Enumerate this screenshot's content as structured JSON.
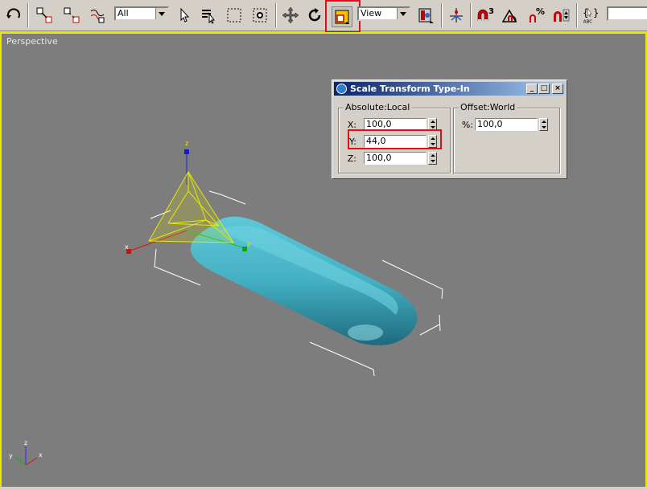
{
  "toolbar": {
    "selection_filter": "All",
    "reference_coord": "View",
    "icons": [
      "undo-icon",
      "select-link-icon",
      "unlink-icon",
      "bind-space-warp-icon",
      "select-object-icon",
      "select-by-name-icon",
      "rectangular-selection-icon",
      "window-crossing-icon",
      "select-and-move-icon",
      "select-and-rotate-icon",
      "select-and-scale-icon",
      "use-pivot-center-icon",
      "select-and-manipulate-icon",
      "snaps-toggle-icon",
      "angle-snap-icon",
      "percent-snap-icon",
      "spinner-snap-icon",
      "edit-named-selections-icon"
    ],
    "snap_label": "3",
    "percent_label": "%",
    "abc_label": "ABC",
    "highlight_color": "#e0101a"
  },
  "viewport": {
    "label": "Perspective",
    "border_color": "#e8e800",
    "background": "#7d7d7d",
    "object_color": "#4ab4c8",
    "gizmo_labels": {
      "x": "x",
      "y": "y",
      "z": "z"
    },
    "axis_tripod": {
      "x": "x",
      "y": "y",
      "z": "z"
    }
  },
  "dialog": {
    "title": "Scale Transform Type-In",
    "absolute_group": "Absolute:Local",
    "offset_group": "Offset:World",
    "x_label": "X:",
    "x_value": "100,0",
    "y_label": "Y:",
    "y_value": "44,0",
    "z_label": "Z:",
    "z_value": "100,0",
    "percent_label": "%:",
    "percent_value": "100,0",
    "minimize": "_",
    "maximize": "□",
    "close": "×"
  }
}
